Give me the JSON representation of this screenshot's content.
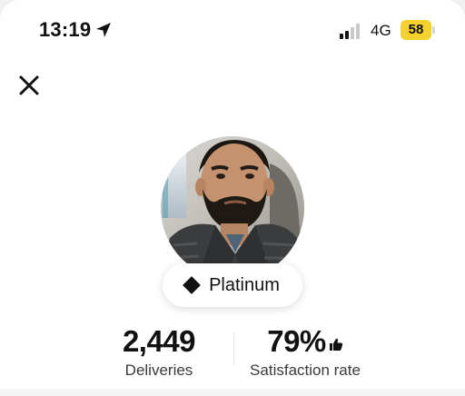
{
  "status_bar": {
    "time": "13:19",
    "network": "4G",
    "battery": "58",
    "battery_color": "#f5d130",
    "icons": [
      "location-arrow-icon",
      "signal-bars-icon"
    ]
  },
  "header": {
    "close_icon": "close-icon"
  },
  "profile": {
    "tier": "Platinum",
    "tier_icon": "diamond-icon"
  },
  "stats": {
    "deliveries_value": "2,449",
    "deliveries_label": "Deliveries",
    "satisfaction_value": "79%",
    "satisfaction_label": "Satisfaction rate",
    "satisfaction_icon": "thumbs-up-icon"
  }
}
